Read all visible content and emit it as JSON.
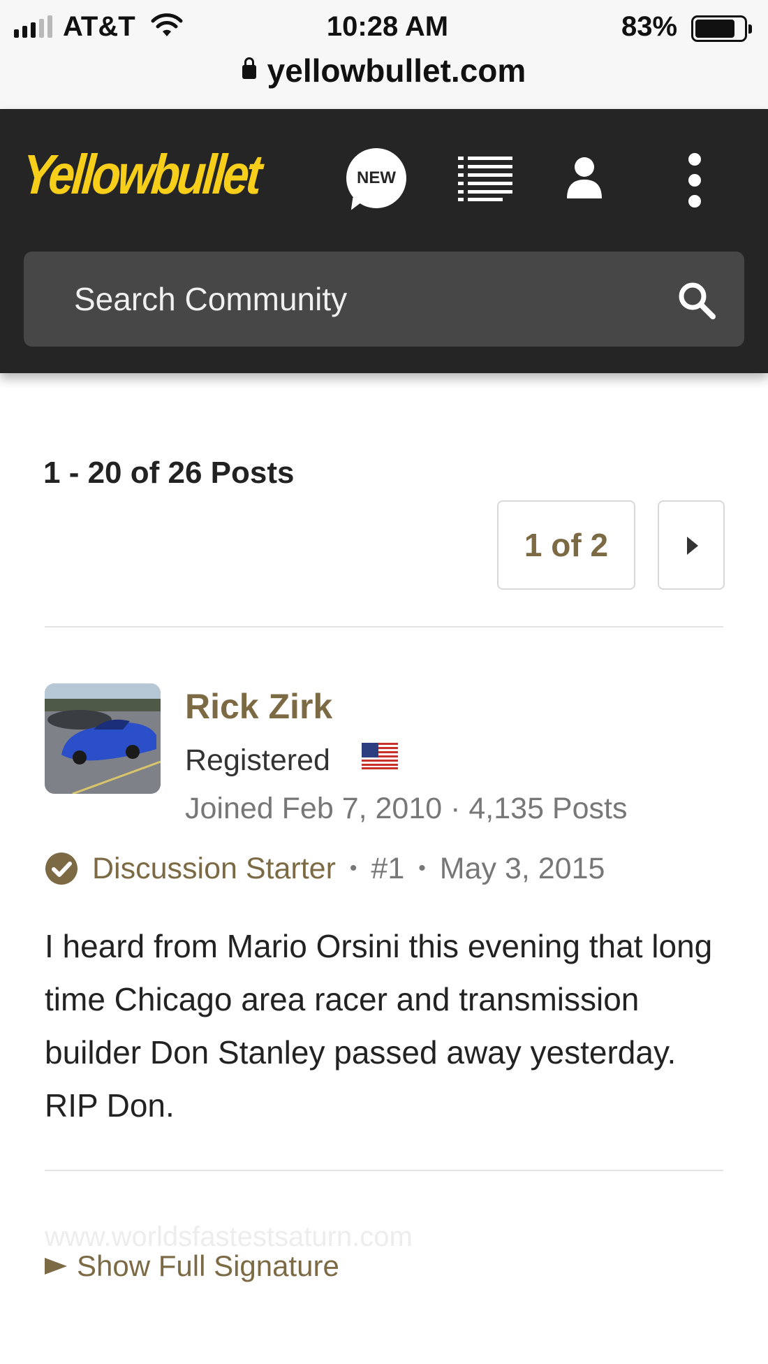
{
  "status_bar": {
    "carrier": "AT&T",
    "time": "10:28 AM",
    "battery": "83%",
    "battery_level": 0.83,
    "url": "yellowbullet.com"
  },
  "header": {
    "logo": "Yellowbullet",
    "new_label": "NEW",
    "search_placeholder": "Search Community",
    "brand_color": "#f7cf1a",
    "background_color": "#252525"
  },
  "pagination": {
    "post_count": "1 - 20 of 26 Posts",
    "page": "1 of 2"
  },
  "post": {
    "author": "Rick Zirk",
    "role": "Registered",
    "joined": "Joined Feb 7, 2010 · 4,135 Posts",
    "starter": "Discussion Starter",
    "number": "#1",
    "date": "May 3, 2015",
    "body": "I heard from Mario Orsini this evening that long time Chicago area racer and transmission builder Don Stanley passed away yesterday. RIP Don.",
    "accent_color": "#7c6a45"
  },
  "signature": {
    "url": "www.worldsfastestsaturn.com",
    "toggle": "Show Full Signature"
  }
}
